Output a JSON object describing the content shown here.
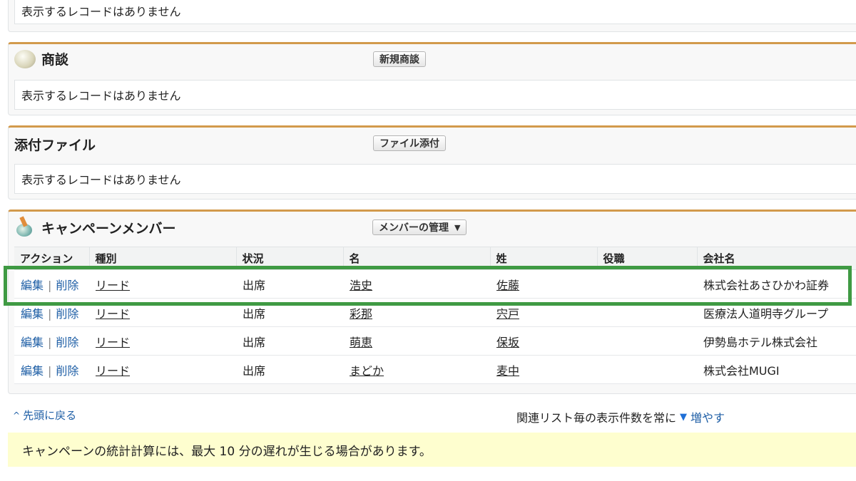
{
  "no_records_text": "表示するレコードはありません",
  "deals": {
    "title": "商談",
    "icon": "deal-icon",
    "new_button": "新規商談",
    "empty": "表示するレコードはありません"
  },
  "attachments": {
    "title": "添付ファイル",
    "attach_button": "ファイル添付",
    "empty": "表示するレコードはありません"
  },
  "campaign_members": {
    "title": "キャンペーンメンバー",
    "icon": "campaign-icon",
    "manage_button": "メンバーの管理",
    "columns": [
      "アクション",
      "種別",
      "状況",
      "名",
      "姓",
      "役職",
      "会社名"
    ],
    "edit_label": "編集",
    "delete_label": "削除",
    "separator": "|",
    "rows": [
      {
        "type": "リード",
        "status": "出席",
        "first_name": "浩史",
        "last_name": "佐藤",
        "title": "",
        "company": "株式会社あさひかわ証券"
      },
      {
        "type": "リード",
        "status": "出席",
        "first_name": "彩那",
        "last_name": "宍戸",
        "title": "",
        "company": "医療法人道明寺グループ"
      },
      {
        "type": "リード",
        "status": "出席",
        "first_name": "萌恵",
        "last_name": "保坂",
        "title": "",
        "company": "伊勢島ホテル株式会社"
      },
      {
        "type": "リード",
        "status": "出席",
        "first_name": "まどか",
        "last_name": "麦中",
        "title": "",
        "company": "株式会社MUGI"
      }
    ]
  },
  "footer": {
    "back_to_top": "先頭に戻る",
    "always_show_prefix": "関連リスト毎の表示件数を常に",
    "always_show_more": "増やす"
  },
  "notice": "キャンペーンの統計計算には、最大 10 分の遅れが生じる場合があります。",
  "colors": {
    "accent": "#d29a4c",
    "link": "#1f5fa6",
    "highlight": "#3f9a43",
    "notice_bg": "#fefecf"
  }
}
